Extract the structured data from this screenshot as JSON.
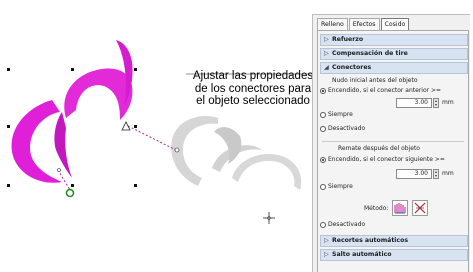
{
  "callout": {
    "line1": "Ajustar las propiedades",
    "line2": "de los conectores para",
    "line3": "el objeto seleccionado"
  },
  "panel": {
    "tabs": [
      "Relleno",
      "Efectos",
      "Cosido"
    ],
    "active_tab": "Cosido",
    "sections": {
      "refuerzo": "Refuerzo",
      "compensacion": "Compensación de tire",
      "conectores": "Conectores",
      "recortes": "Recortes automáticos",
      "salto": "Salto automático"
    },
    "tie_in": {
      "heading": "Nudo inicial antes del objeto",
      "option_on": "Encendido, si el conector anterior >=",
      "value": "3.00",
      "unit": "mm",
      "option_always": "Siempre",
      "option_off": "Desactivado"
    },
    "tie_off": {
      "heading": "Remate después del objeto",
      "option_on": "Encendido, si el conector siguiente >=",
      "value": "3.00",
      "unit": "mm",
      "option_always": "Siempre",
      "method_label": "Método:",
      "option_off": "Desactivado"
    }
  },
  "colors": {
    "selected_object": "#e020d8",
    "ghost_object": "#cfcfcf",
    "section_header": "#d8e3f2",
    "connector_line": "#b0209a"
  }
}
